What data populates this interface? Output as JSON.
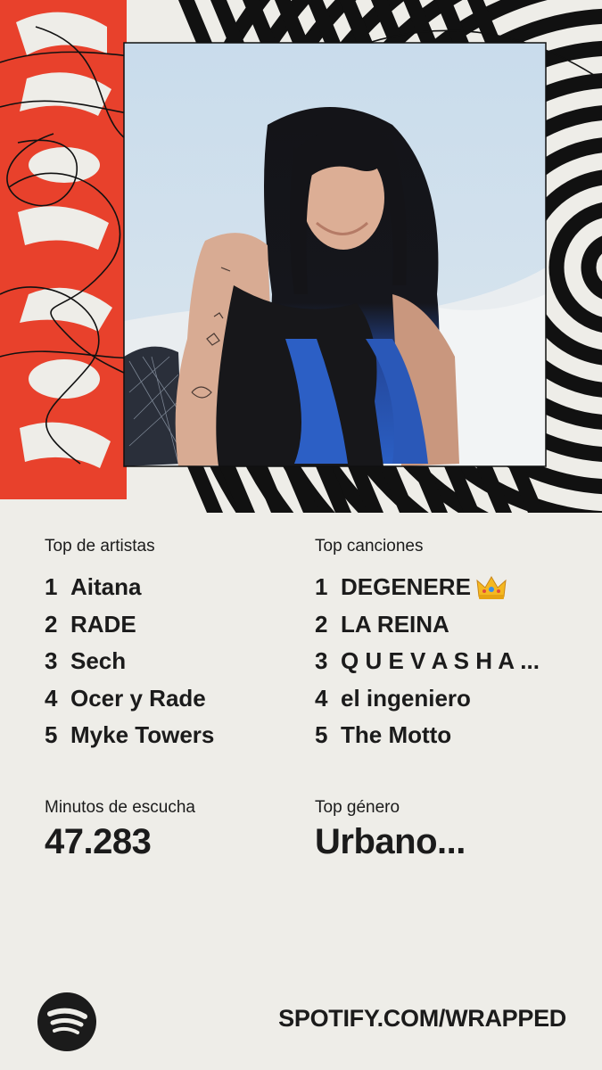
{
  "hero": {
    "year_graphic": "2025",
    "brand_color": "#e8412c"
  },
  "top_artists": {
    "label": "Top de artistas",
    "items": [
      {
        "rank": "1",
        "name": "Aitana"
      },
      {
        "rank": "2",
        "name": "RADE"
      },
      {
        "rank": "3",
        "name": "Sech"
      },
      {
        "rank": "4",
        "name": "Ocer y Rade"
      },
      {
        "rank": "5",
        "name": "Myke Towers"
      }
    ]
  },
  "top_songs": {
    "label": "Top canciones",
    "items": [
      {
        "rank": "1",
        "name": "DEGENERE"
      },
      {
        "rank": "2",
        "name": "LA REINA"
      },
      {
        "rank": "3",
        "name": "Q U E V A S H A ..."
      },
      {
        "rank": "4",
        "name": "el ingeniero"
      },
      {
        "rank": "5",
        "name": "The Motto"
      }
    ]
  },
  "minutes": {
    "label": "Minutos de escucha",
    "value": "47.283"
  },
  "genre": {
    "label": "Top género",
    "value": "Urbano..."
  },
  "footer": {
    "url": "SPOTIFY.COM/WRAPPED"
  }
}
